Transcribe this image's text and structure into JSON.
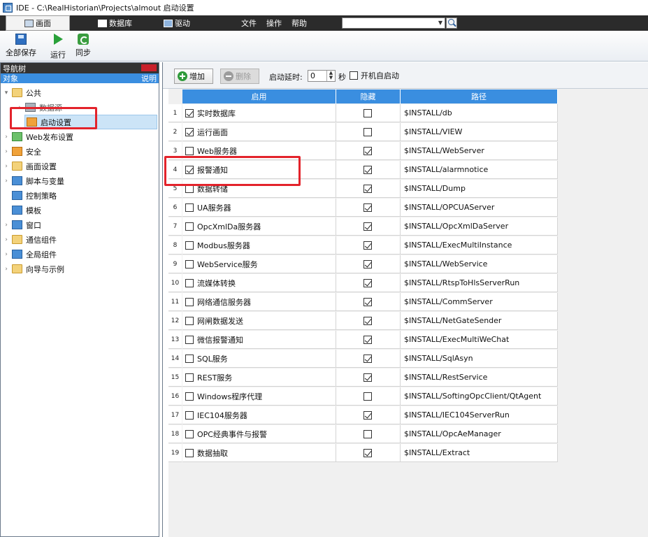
{
  "window": {
    "title": "IDE - C:\\RealHistorian\\Projects\\almout  启动设置"
  },
  "topbar": {
    "tabs": [
      {
        "label": "画面",
        "active": true
      },
      {
        "label": "数据库",
        "active": false
      },
      {
        "label": "驱动",
        "active": false
      }
    ],
    "menus": [
      "文件",
      "操作",
      "帮助"
    ],
    "search_value": ""
  },
  "toolbar": {
    "save_all": "全部保存",
    "run": "运行",
    "sync": "同步"
  },
  "nav": {
    "title": "导航树",
    "col_object": "对象",
    "col_desc": "说明",
    "items": [
      {
        "label": "公共",
        "expanded": true
      },
      {
        "label": "数据源"
      },
      {
        "label": "启动设置",
        "selected": true
      },
      {
        "label": "Web发布设置"
      },
      {
        "label": "安全"
      },
      {
        "label": "画面设置"
      },
      {
        "label": "脚本与变量"
      },
      {
        "label": "控制策略"
      },
      {
        "label": "模板"
      },
      {
        "label": "窗口"
      },
      {
        "label": "通信组件"
      },
      {
        "label": "全局组件"
      },
      {
        "label": "向导与示例"
      }
    ]
  },
  "content": {
    "add_label": "增加",
    "delete_label": "删除",
    "delay_label": "启动延时:",
    "delay_value": "0",
    "sec_label": "秒",
    "autostart_label": "开机自启动",
    "autostart_checked": false,
    "columns": [
      "启用",
      "隐藏",
      "路径"
    ],
    "rows": [
      {
        "num": "1",
        "name": "实时数据库",
        "enabled": true,
        "hidden": false,
        "path": "$INSTALL/db"
      },
      {
        "num": "2",
        "name": "运行画面",
        "enabled": true,
        "hidden": false,
        "path": "$INSTALL/VIEW"
      },
      {
        "num": "3",
        "name": "Web服务器",
        "enabled": false,
        "hidden": true,
        "path": "$INSTALL/WebServer"
      },
      {
        "num": "4",
        "name": "报警通知",
        "enabled": true,
        "hidden": true,
        "path": "$INSTALL/alarmnotice"
      },
      {
        "num": "5",
        "name": "数据转储",
        "enabled": false,
        "hidden": true,
        "path": "$INSTALL/Dump"
      },
      {
        "num": "6",
        "name": "UA服务器",
        "enabled": false,
        "hidden": true,
        "path": "$INSTALL/OPCUAServer"
      },
      {
        "num": "7",
        "name": "OpcXmlDa服务器",
        "enabled": false,
        "hidden": true,
        "path": "$INSTALL/OpcXmlDaServer"
      },
      {
        "num": "8",
        "name": "Modbus服务器",
        "enabled": false,
        "hidden": true,
        "path": "$INSTALL/ExecMultiInstance"
      },
      {
        "num": "9",
        "name": "WebService服务",
        "enabled": false,
        "hidden": true,
        "path": "$INSTALL/WebService"
      },
      {
        "num": "10",
        "name": "流媒体转换",
        "enabled": false,
        "hidden": true,
        "path": "$INSTALL/RtspToHlsServerRun"
      },
      {
        "num": "11",
        "name": "网络通信服务器",
        "enabled": false,
        "hidden": true,
        "path": "$INSTALL/CommServer"
      },
      {
        "num": "12",
        "name": "网闸数据发送",
        "enabled": false,
        "hidden": true,
        "path": "$INSTALL/NetGateSender"
      },
      {
        "num": "13",
        "name": "微信报警通知",
        "enabled": false,
        "hidden": true,
        "path": "$INSTALL/ExecMultiWeChat"
      },
      {
        "num": "14",
        "name": "SQL服务",
        "enabled": false,
        "hidden": true,
        "path": "$INSTALL/SqlAsyn"
      },
      {
        "num": "15",
        "name": "REST服务",
        "enabled": false,
        "hidden": true,
        "path": "$INSTALL/RestService"
      },
      {
        "num": "16",
        "name": "Windows程序代理",
        "enabled": false,
        "hidden": false,
        "path": "$INSTALL/SoftingOpcClient/QtAgent"
      },
      {
        "num": "17",
        "name": "IEC104服务器",
        "enabled": false,
        "hidden": true,
        "path": "$INSTALL/IEC104ServerRun"
      },
      {
        "num": "18",
        "name": "OPC经典事件与报警",
        "enabled": false,
        "hidden": false,
        "path": "$INSTALL/OpcAeManager"
      },
      {
        "num": "19",
        "name": "数据抽取",
        "enabled": false,
        "hidden": true,
        "path": "$INSTALL/Extract"
      }
    ]
  },
  "colors": {
    "header_blue": "#3a8ee0",
    "highlight_red": "#e3232b",
    "dark_bar": "#2b2b2b"
  }
}
